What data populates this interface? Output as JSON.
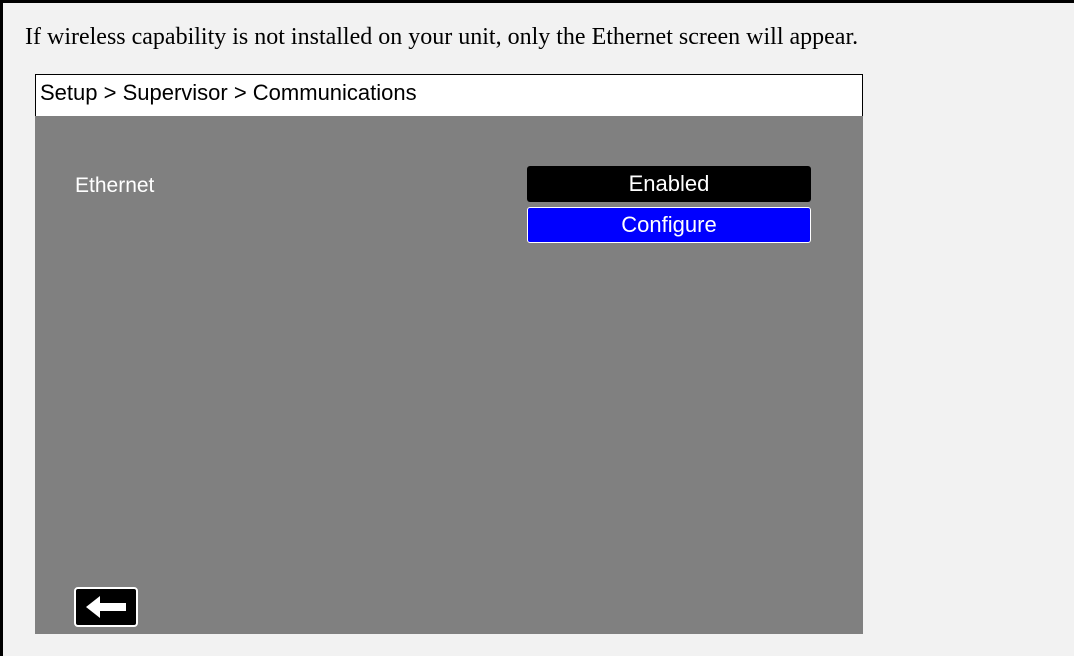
{
  "caption": "If wireless capability is not installed on your unit, only the Ethernet screen will appear.",
  "screen": {
    "breadcrumb": "Setup > Supervisor > Communications",
    "ethernet": {
      "label": "Ethernet",
      "status_button": "Enabled",
      "configure_button": "Configure"
    },
    "back_icon": "left-arrow-icon"
  },
  "colors": {
    "screen_background": "#808080",
    "configure_button": "#0000ff",
    "status_button": "#000000"
  }
}
